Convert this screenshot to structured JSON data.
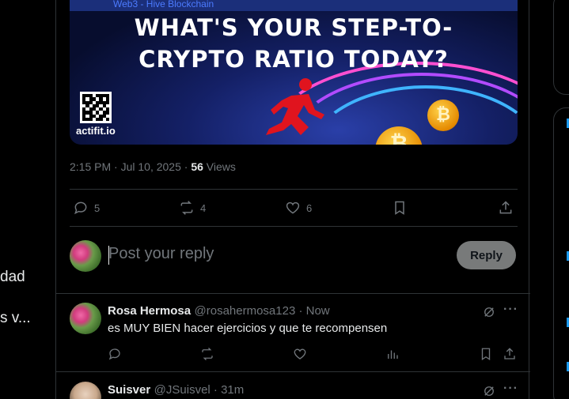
{
  "left": {
    "line1": "dad",
    "line2": "s v..."
  },
  "banner": {
    "tag": "Web3 - Hive Blockchain",
    "title_line1": "WHAT'S YOUR STEP-TO-",
    "title_line2": "CRYPTO RATIO TODAY?",
    "brand": "actifit.io",
    "coin_symbol": "₿"
  },
  "post": {
    "time": "2:15 PM · Jul 10, 2025 · ",
    "views_count": "56",
    "views_label": " Views"
  },
  "actions": {
    "replies": "5",
    "reposts": "4",
    "likes": "6"
  },
  "composer": {
    "placeholder": "Post your reply",
    "button": "Reply"
  },
  "comments": [
    {
      "name": "Rosa Hermosa",
      "meta": "@rosahermosa123 · Now",
      "text": "es MUY BIEN hacer ejercicios y que te recompensen"
    },
    {
      "name": "Suisver",
      "meta": "@JSuisvel · 31m",
      "text": ""
    }
  ],
  "colors": {
    "background": "#000000",
    "border": "#2f3336",
    "muted": "#71767b",
    "text": "#e7e9ea",
    "accent": "#1d9bf0",
    "reply_button": "#787a7a"
  },
  "icons": [
    "reply-icon",
    "repost-icon",
    "like-icon",
    "bookmark-icon",
    "share-icon",
    "analytics-icon",
    "grok-icon",
    "more-icon"
  ]
}
